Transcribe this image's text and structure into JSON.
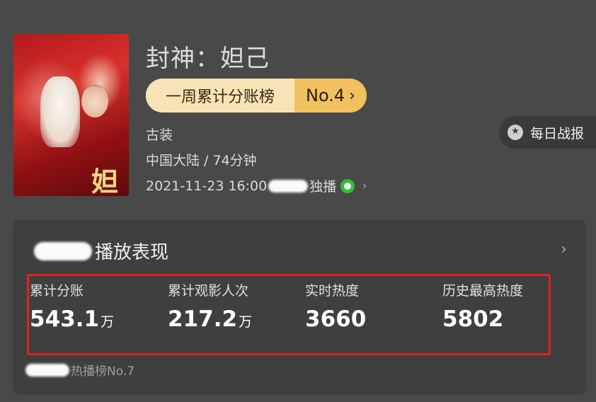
{
  "movie": {
    "title": "封神：妲己",
    "poster_calligraphy": "妲己",
    "genre": "古装",
    "region_duration": "中国大陆 / 74分钟",
    "release_prefix": "2021-11-23 16:00",
    "exclusive_label": "独播",
    "platform_icon": "iqiyi-logo-icon"
  },
  "ranking": {
    "label": "一周累计分账榜",
    "number": "No.4",
    "chevron": "›"
  },
  "daily_report": {
    "label": "每日战报",
    "icon_glyph": "★"
  },
  "performance": {
    "title_suffix": "播放表现",
    "chevron": "›",
    "stats": [
      {
        "label": "累计分账",
        "value": "543.1",
        "unit": "万"
      },
      {
        "label": "累计观影人次",
        "value": "217.2",
        "unit": "万"
      },
      {
        "label": "实时热度",
        "value": "3660",
        "unit": ""
      },
      {
        "label": "历史最高热度",
        "value": "5802",
        "unit": ""
      }
    ],
    "footer": "热播榜No.7"
  },
  "colors": {
    "background": "#494949",
    "card": "#3f3f3f",
    "rank_gold": "#f1c15f",
    "highlight_border": "#e0231f",
    "iqiyi_green": "#2fbe3a"
  }
}
